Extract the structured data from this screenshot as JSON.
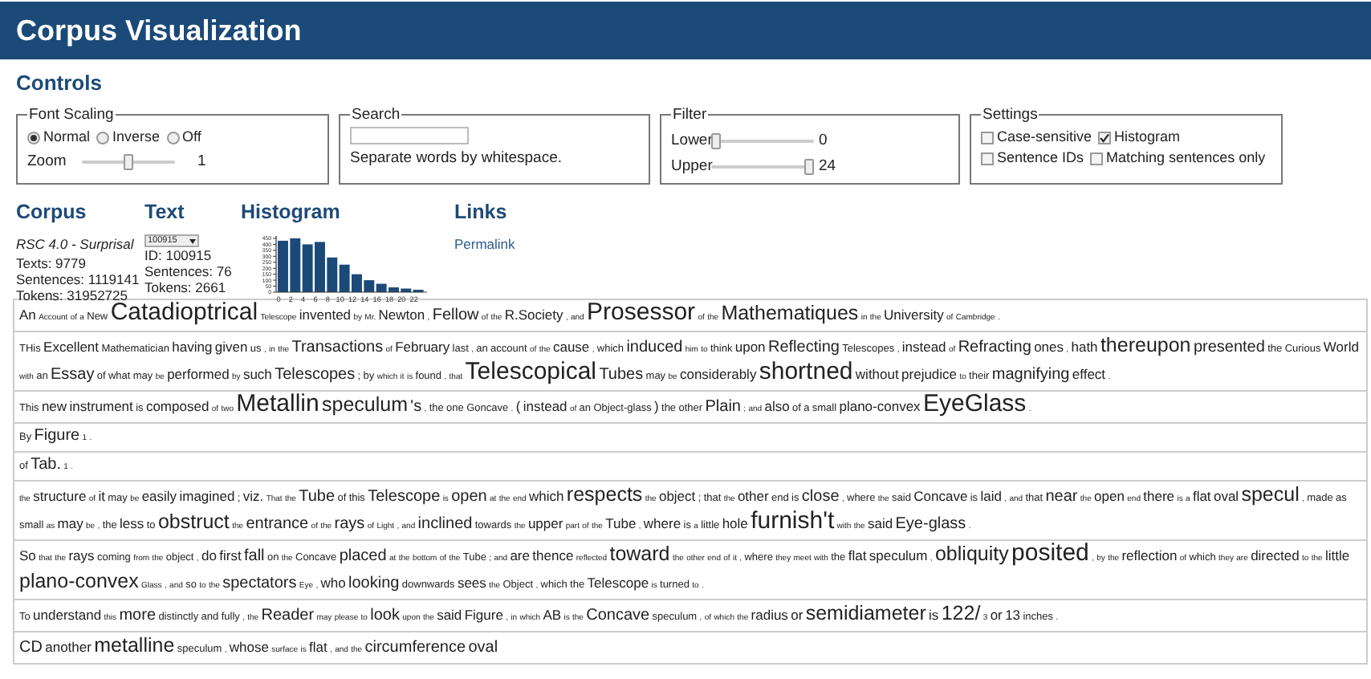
{
  "header": {
    "title": "Corpus Visualization"
  },
  "controls": {
    "heading": "Controls",
    "font_scaling": {
      "legend": "Font Scaling",
      "options": [
        {
          "label": "Normal",
          "selected": true
        },
        {
          "label": "Inverse",
          "selected": false
        },
        {
          "label": "Off",
          "selected": false
        }
      ],
      "zoom": {
        "label": "Zoom",
        "level": 0.5,
        "reading": "1"
      }
    },
    "search": {
      "legend": "Search",
      "hint": "Separate words by whitespace."
    },
    "filter": {
      "legend": "Filter",
      "sliders": [
        {
          "label": "Lower",
          "level": 0,
          "reading": "0"
        },
        {
          "label": "Upper",
          "level": 1,
          "reading": "24"
        }
      ]
    },
    "settings": {
      "legend": "Settings",
      "rows": [
        [
          {
            "label": "Case-sensitive",
            "checked": false
          },
          {
            "label": "Histogram",
            "checked": true
          }
        ],
        [
          {
            "label": "Sentence IDs",
            "checked": false
          },
          {
            "label": "Matching sentences only",
            "checked": false
          }
        ]
      ]
    }
  },
  "corpus": {
    "heading": "Corpus",
    "name": "RSC 4.0 - Surprisal",
    "lines": [
      "Texts: 9779",
      "Sentences: 1119141",
      "Tokens: 31952725"
    ]
  },
  "text": {
    "heading": "Text",
    "select": "100915",
    "lines": [
      "ID: 100915",
      "Sentences: 76",
      "Tokens: 2661"
    ]
  },
  "histogram": {
    "heading": "Histogram",
    "chart_data": {
      "type": "bar",
      "categories": [
        "0",
        "2",
        "4",
        "6",
        "8",
        "10",
        "12",
        "14",
        "16",
        "18",
        "20",
        "22"
      ],
      "values": [
        430,
        450,
        400,
        420,
        290,
        230,
        150,
        100,
        70,
        40,
        30,
        20
      ],
      "yticks": [
        0,
        50,
        100,
        150,
        200,
        250,
        300,
        350,
        400,
        450
      ],
      "ylim": [
        0,
        470
      ]
    }
  },
  "links": {
    "heading": "Links",
    "items": [
      "Permalink"
    ]
  },
  "sentences": [
    [
      {
        "w": "An",
        "kind": "m"
      },
      {
        "w": "Account",
        "kind": "xs"
      },
      {
        "w": "of",
        "kind": "xs"
      },
      {
        "w": "a",
        "kind": "xs"
      },
      {
        "w": "New",
        "kind": "s"
      },
      {
        "w": "Catadioptrical",
        "kind": "xxl"
      },
      {
        "w": "Telescope",
        "kind": "xs"
      },
      {
        "w": "invented",
        "kind": "m"
      },
      {
        "w": "by",
        "kind": "xs"
      },
      {
        "w": "Mr.",
        "kind": "xs"
      },
      {
        "w": "Newton",
        "kind": "m"
      },
      {
        "w": ",",
        "kind": "xs"
      },
      {
        "w": "Fellow",
        "kind": "l"
      },
      {
        "w": "of",
        "kind": "xs"
      },
      {
        "w": "the",
        "kind": "xs"
      },
      {
        "w": "R.Society",
        "kind": "m"
      },
      {
        "w": ",",
        "kind": "xs"
      },
      {
        "w": "and",
        "kind": "xs"
      },
      {
        "w": "Prosessor",
        "kind": "xxl"
      },
      {
        "w": "of",
        "kind": "xs"
      },
      {
        "w": "the",
        "kind": "xs"
      },
      {
        "w": "Mathematiques",
        "kind": "xl"
      },
      {
        "w": "in",
        "kind": "xs"
      },
      {
        "w": "the",
        "kind": "xs"
      },
      {
        "w": "University",
        "kind": "m"
      },
      {
        "w": "of",
        "kind": "xs"
      },
      {
        "w": "Cambridge",
        "kind": "xs"
      },
      {
        "w": ".",
        "kind": "xs"
      }
    ],
    [
      {
        "w": "THis",
        "kind": "s"
      },
      {
        "w": "Excellent",
        "kind": "m"
      },
      {
        "w": "Mathematician",
        "kind": "s"
      },
      {
        "w": "having",
        "kind": "m"
      },
      {
        "w": "given",
        "kind": "m"
      },
      {
        "w": "us",
        "kind": "s"
      },
      {
        "w": ",",
        "kind": "xs"
      },
      {
        "w": "in",
        "kind": "xs"
      },
      {
        "w": "the",
        "kind": "xs"
      },
      {
        "w": "Transactions",
        "kind": "l"
      },
      {
        "w": "of",
        "kind": "xs"
      },
      {
        "w": "February",
        "kind": "m"
      },
      {
        "w": "last",
        "kind": "s"
      },
      {
        "w": ",",
        "kind": "xs"
      },
      {
        "w": "an",
        "kind": "s"
      },
      {
        "w": "account",
        "kind": "s"
      },
      {
        "w": "of",
        "kind": "xs"
      },
      {
        "w": "the",
        "kind": "xs"
      },
      {
        "w": "cause",
        "kind": "m"
      },
      {
        "w": ",",
        "kind": "xs"
      },
      {
        "w": "which",
        "kind": "s"
      },
      {
        "w": "induced",
        "kind": "l"
      },
      {
        "w": "him",
        "kind": "xs"
      },
      {
        "w": "to",
        "kind": "xs"
      },
      {
        "w": "think",
        "kind": "s"
      },
      {
        "w": "upon",
        "kind": "m"
      },
      {
        "w": "Reflecting",
        "kind": "l"
      },
      {
        "w": "Telescopes",
        "kind": "s"
      },
      {
        "w": ",",
        "kind": "xs"
      },
      {
        "w": "instead",
        "kind": "m"
      },
      {
        "w": "of",
        "kind": "xs"
      },
      {
        "w": "Refracting",
        "kind": "l"
      },
      {
        "w": "ones",
        "kind": "m"
      },
      {
        "w": ",",
        "kind": "xs"
      },
      {
        "w": "hath",
        "kind": "m"
      },
      {
        "w": "thereupon",
        "kind": "xl"
      },
      {
        "w": "presented",
        "kind": "l"
      },
      {
        "w": "the",
        "kind": "s"
      },
      {
        "w": "Curious",
        "kind": "s"
      },
      {
        "w": "World",
        "kind": "m"
      },
      {
        "w": "with",
        "kind": "xs"
      },
      {
        "w": "an",
        "kind": "s"
      },
      {
        "w": "Essay",
        "kind": "l"
      },
      {
        "w": "of",
        "kind": "s"
      },
      {
        "w": "what",
        "kind": "s"
      },
      {
        "w": "may",
        "kind": "s"
      },
      {
        "w": "be",
        "kind": "xs"
      },
      {
        "w": "performed",
        "kind": "m"
      },
      {
        "w": "by",
        "kind": "xs"
      },
      {
        "w": "such",
        "kind": "m"
      },
      {
        "w": "Telescopes",
        "kind": "l"
      },
      {
        "w": ";",
        "kind": "s"
      },
      {
        "w": "by",
        "kind": "s"
      },
      {
        "w": "which",
        "kind": "xs"
      },
      {
        "w": "it",
        "kind": "xs"
      },
      {
        "w": "is",
        "kind": "xs"
      },
      {
        "w": "found",
        "kind": "s"
      },
      {
        "w": ",",
        "kind": "xs"
      },
      {
        "w": "that",
        "kind": "xs"
      },
      {
        "w": "Telescopical",
        "kind": "xxl"
      },
      {
        "w": "Tubes",
        "kind": "l"
      },
      {
        "w": "may",
        "kind": "s"
      },
      {
        "w": "be",
        "kind": "xs"
      },
      {
        "w": "considerably",
        "kind": "m"
      },
      {
        "w": "shortned",
        "kind": "xxl"
      },
      {
        "w": "without",
        "kind": "m"
      },
      {
        "w": "prejudice",
        "kind": "m"
      },
      {
        "w": "to",
        "kind": "xs"
      },
      {
        "w": "their",
        "kind": "s"
      },
      {
        "w": "magnifying",
        "kind": "l"
      },
      {
        "w": "effect",
        "kind": "m"
      },
      {
        "w": ".",
        "kind": "xs"
      }
    ],
    [
      {
        "w": "This",
        "kind": "s"
      },
      {
        "w": "new",
        "kind": "m"
      },
      {
        "w": "instrument",
        "kind": "m"
      },
      {
        "w": "is",
        "kind": "s"
      },
      {
        "w": "composed",
        "kind": "m"
      },
      {
        "w": "of",
        "kind": "xs"
      },
      {
        "w": "two",
        "kind": "xs"
      },
      {
        "w": "Metallin",
        "kind": "xxl"
      },
      {
        "w": "speculum",
        "kind": "xl"
      },
      {
        "w": "'s",
        "kind": "l"
      },
      {
        "w": ",",
        "kind": "xs"
      },
      {
        "w": "the",
        "kind": "s"
      },
      {
        "w": "one",
        "kind": "s"
      },
      {
        "w": "Goncave",
        "kind": "s"
      },
      {
        "w": ".",
        "kind": "xs"
      },
      {
        "w": "(",
        "kind": "m"
      },
      {
        "w": "instead",
        "kind": "m"
      },
      {
        "w": "of",
        "kind": "xs"
      },
      {
        "w": "an",
        "kind": "s"
      },
      {
        "w": "Object-glass",
        "kind": "s"
      },
      {
        "w": ")",
        "kind": "m"
      },
      {
        "w": "the",
        "kind": "s"
      },
      {
        "w": "other",
        "kind": "s"
      },
      {
        "w": "Plain",
        "kind": "l"
      },
      {
        "w": ";",
        "kind": "xs"
      },
      {
        "w": "and",
        "kind": "xs"
      },
      {
        "w": "also",
        "kind": "m"
      },
      {
        "w": "of",
        "kind": "s"
      },
      {
        "w": "a",
        "kind": "s"
      },
      {
        "w": "small",
        "kind": "s"
      },
      {
        "w": "plano-convex",
        "kind": "m"
      },
      {
        "w": "EyeGlass",
        "kind": "xxl"
      },
      {
        "w": ".",
        "kind": "xs"
      }
    ],
    [
      {
        "w": "By",
        "kind": "s"
      },
      {
        "w": "Figure",
        "kind": "l"
      },
      {
        "w": "1",
        "kind": "xs"
      },
      {
        "w": ".",
        "kind": "xs"
      }
    ],
    [
      {
        "w": "of",
        "kind": "s"
      },
      {
        "w": "Tab.",
        "kind": "l"
      },
      {
        "w": "1",
        "kind": "xs"
      },
      {
        "w": ".",
        "kind": "xs"
      }
    ],
    [
      {
        "w": "the",
        "kind": "xs"
      },
      {
        "w": "structure",
        "kind": "m"
      },
      {
        "w": "of",
        "kind": "xs"
      },
      {
        "w": "it",
        "kind": "m"
      },
      {
        "w": "may",
        "kind": "s"
      },
      {
        "w": "be",
        "kind": "xs"
      },
      {
        "w": "easily",
        "kind": "m"
      },
      {
        "w": "imagined",
        "kind": "m"
      },
      {
        "w": ";",
        "kind": "s"
      },
      {
        "w": "viz.",
        "kind": "m"
      },
      {
        "w": "That",
        "kind": "xs"
      },
      {
        "w": "the",
        "kind": "xs"
      },
      {
        "w": "Tube",
        "kind": "l"
      },
      {
        "w": "of",
        "kind": "s"
      },
      {
        "w": "this",
        "kind": "s"
      },
      {
        "w": "Telescope",
        "kind": "l"
      },
      {
        "w": "is",
        "kind": "xs"
      },
      {
        "w": "open",
        "kind": "l"
      },
      {
        "w": "at",
        "kind": "xs"
      },
      {
        "w": "the",
        "kind": "xs"
      },
      {
        "w": "end",
        "kind": "xs"
      },
      {
        "w": "which",
        "kind": "m"
      },
      {
        "w": "respects",
        "kind": "xl"
      },
      {
        "w": "the",
        "kind": "xs"
      },
      {
        "w": "object",
        "kind": "m"
      },
      {
        "w": ";",
        "kind": "s"
      },
      {
        "w": "that",
        "kind": "s"
      },
      {
        "w": "the",
        "kind": "xs"
      },
      {
        "w": "other",
        "kind": "m"
      },
      {
        "w": "end",
        "kind": "s"
      },
      {
        "w": "is",
        "kind": "s"
      },
      {
        "w": "close",
        "kind": "l"
      },
      {
        "w": ",",
        "kind": "xs"
      },
      {
        "w": "where",
        "kind": "s"
      },
      {
        "w": "the",
        "kind": "xs"
      },
      {
        "w": "said",
        "kind": "s"
      },
      {
        "w": "Concave",
        "kind": "m"
      },
      {
        "w": "is",
        "kind": "s"
      },
      {
        "w": "laid",
        "kind": "m"
      },
      {
        "w": ",",
        "kind": "xs"
      },
      {
        "w": "and",
        "kind": "xs"
      },
      {
        "w": "that",
        "kind": "s"
      },
      {
        "w": "near",
        "kind": "l"
      },
      {
        "w": "the",
        "kind": "xs"
      },
      {
        "w": "open",
        "kind": "m"
      },
      {
        "w": "end",
        "kind": "xs"
      },
      {
        "w": "there",
        "kind": "m"
      },
      {
        "w": "is",
        "kind": "xs"
      },
      {
        "w": "a",
        "kind": "xs"
      },
      {
        "w": "flat",
        "kind": "m"
      },
      {
        "w": "oval",
        "kind": "m"
      },
      {
        "w": "specul",
        "kind": "xl"
      },
      {
        "w": ",",
        "kind": "xs"
      },
      {
        "w": "made",
        "kind": "s"
      },
      {
        "w": "as",
        "kind": "s"
      },
      {
        "w": "small",
        "kind": "s"
      },
      {
        "w": "as",
        "kind": "xs"
      },
      {
        "w": "may",
        "kind": "m"
      },
      {
        "w": "be",
        "kind": "xs"
      },
      {
        "w": ",",
        "kind": "xs"
      },
      {
        "w": "the",
        "kind": "s"
      },
      {
        "w": "less",
        "kind": "m"
      },
      {
        "w": "to",
        "kind": "s"
      },
      {
        "w": "obstruct",
        "kind": "xl"
      },
      {
        "w": "the",
        "kind": "xs"
      },
      {
        "w": "entrance",
        "kind": "l"
      },
      {
        "w": "of",
        "kind": "xs"
      },
      {
        "w": "the",
        "kind": "xs"
      },
      {
        "w": "rays",
        "kind": "l"
      },
      {
        "w": "of",
        "kind": "xs"
      },
      {
        "w": "Light",
        "kind": "xs"
      },
      {
        "w": ",",
        "kind": "xs"
      },
      {
        "w": "and",
        "kind": "xs"
      },
      {
        "w": "inclined",
        "kind": "l"
      },
      {
        "w": "towards",
        "kind": "s"
      },
      {
        "w": "the",
        "kind": "xs"
      },
      {
        "w": "upper",
        "kind": "m"
      },
      {
        "w": "part",
        "kind": "xs"
      },
      {
        "w": "of",
        "kind": "xs"
      },
      {
        "w": "the",
        "kind": "xs"
      },
      {
        "w": "Tube",
        "kind": "m"
      },
      {
        "w": ",",
        "kind": "xs"
      },
      {
        "w": "where",
        "kind": "m"
      },
      {
        "w": "is",
        "kind": "s"
      },
      {
        "w": "a",
        "kind": "xs"
      },
      {
        "w": "little",
        "kind": "s"
      },
      {
        "w": "hole",
        "kind": "m"
      },
      {
        "w": "furnish't",
        "kind": "xxl"
      },
      {
        "w": "with",
        "kind": "xs"
      },
      {
        "w": "the",
        "kind": "xs"
      },
      {
        "w": "said",
        "kind": "m"
      },
      {
        "w": "Eye-glass",
        "kind": "l"
      },
      {
        "w": ".",
        "kind": "xs"
      }
    ],
    [
      {
        "w": "So",
        "kind": "m"
      },
      {
        "w": "that",
        "kind": "xs"
      },
      {
        "w": "the",
        "kind": "xs"
      },
      {
        "w": "rays",
        "kind": "m"
      },
      {
        "w": "coming",
        "kind": "s"
      },
      {
        "w": "from",
        "kind": "xs"
      },
      {
        "w": "the",
        "kind": "xs"
      },
      {
        "w": "object",
        "kind": "s"
      },
      {
        "w": ",",
        "kind": "xs"
      },
      {
        "w": "do",
        "kind": "m"
      },
      {
        "w": "first",
        "kind": "m"
      },
      {
        "w": "fall",
        "kind": "l"
      },
      {
        "w": "on",
        "kind": "s"
      },
      {
        "w": "the",
        "kind": "xs"
      },
      {
        "w": "Concave",
        "kind": "s"
      },
      {
        "w": "placed",
        "kind": "l"
      },
      {
        "w": "at",
        "kind": "xs"
      },
      {
        "w": "the",
        "kind": "xs"
      },
      {
        "w": "bottom",
        "kind": "xs"
      },
      {
        "w": "of",
        "kind": "xs"
      },
      {
        "w": "the",
        "kind": "xs"
      },
      {
        "w": "Tube",
        "kind": "s"
      },
      {
        "w": ";",
        "kind": "xs"
      },
      {
        "w": "and",
        "kind": "xs"
      },
      {
        "w": "are",
        "kind": "m"
      },
      {
        "w": "thence",
        "kind": "m"
      },
      {
        "w": "reflected",
        "kind": "xs"
      },
      {
        "w": "toward",
        "kind": "xl"
      },
      {
        "w": "the",
        "kind": "xs"
      },
      {
        "w": "other",
        "kind": "xs"
      },
      {
        "w": "end",
        "kind": "xs"
      },
      {
        "w": "of",
        "kind": "xs"
      },
      {
        "w": "it",
        "kind": "xs"
      },
      {
        "w": ",",
        "kind": "xs"
      },
      {
        "w": "where",
        "kind": "s"
      },
      {
        "w": "they",
        "kind": "xs"
      },
      {
        "w": "meet",
        "kind": "xs"
      },
      {
        "w": "with",
        "kind": "xs"
      },
      {
        "w": "the",
        "kind": "s"
      },
      {
        "w": "flat",
        "kind": "m"
      },
      {
        "w": "speculum",
        "kind": "m"
      },
      {
        "w": ",",
        "kind": "xs"
      },
      {
        "w": "obliquity",
        "kind": "xl"
      },
      {
        "w": "posited",
        "kind": "xxl"
      },
      {
        "w": ",",
        "kind": "xs"
      },
      {
        "w": "by",
        "kind": "xs"
      },
      {
        "w": "the",
        "kind": "xs"
      },
      {
        "w": "reflection",
        "kind": "m"
      },
      {
        "w": "of",
        "kind": "xs"
      },
      {
        "w": "which",
        "kind": "s"
      },
      {
        "w": "they",
        "kind": "xs"
      },
      {
        "w": "are",
        "kind": "xs"
      },
      {
        "w": "directed",
        "kind": "m"
      },
      {
        "w": "to",
        "kind": "xs"
      },
      {
        "w": "the",
        "kind": "xs"
      },
      {
        "w": "little",
        "kind": "m"
      },
      {
        "w": "plano-convex",
        "kind": "xl"
      },
      {
        "w": "Glass",
        "kind": "xs"
      },
      {
        "w": ",",
        "kind": "xs"
      },
      {
        "w": "and",
        "kind": "xs"
      },
      {
        "w": "so",
        "kind": "s"
      },
      {
        "w": "to",
        "kind": "xs"
      },
      {
        "w": "the",
        "kind": "xs"
      },
      {
        "w": "spectators",
        "kind": "l"
      },
      {
        "w": "Eye",
        "kind": "xs"
      },
      {
        "w": ",",
        "kind": "xs"
      },
      {
        "w": "who",
        "kind": "m"
      },
      {
        "w": "looking",
        "kind": "l"
      },
      {
        "w": "downwards",
        "kind": "s"
      },
      {
        "w": "sees",
        "kind": "m"
      },
      {
        "w": "the",
        "kind": "xs"
      },
      {
        "w": "Object",
        "kind": "s"
      },
      {
        "w": ",",
        "kind": "xs"
      },
      {
        "w": "which",
        "kind": "s"
      },
      {
        "w": "the",
        "kind": "s"
      },
      {
        "w": "Telescope",
        "kind": "m"
      },
      {
        "w": "is",
        "kind": "xs"
      },
      {
        "w": "turned",
        "kind": "s"
      },
      {
        "w": "to",
        "kind": "xs"
      },
      {
        "w": ".",
        "kind": "xs"
      }
    ],
    [
      {
        "w": "To",
        "kind": "s"
      },
      {
        "w": "understand",
        "kind": "m"
      },
      {
        "w": "this",
        "kind": "xs"
      },
      {
        "w": "more",
        "kind": "l"
      },
      {
        "w": "distinctly",
        "kind": "s"
      },
      {
        "w": "and",
        "kind": "s"
      },
      {
        "w": "fully",
        "kind": "s"
      },
      {
        "w": ",",
        "kind": "xs"
      },
      {
        "w": "the",
        "kind": "xs"
      },
      {
        "w": "Reader",
        "kind": "l"
      },
      {
        "w": "may",
        "kind": "xs"
      },
      {
        "w": "please",
        "kind": "xs"
      },
      {
        "w": "to",
        "kind": "xs"
      },
      {
        "w": "look",
        "kind": "l"
      },
      {
        "w": "upon",
        "kind": "xs"
      },
      {
        "w": "the",
        "kind": "xs"
      },
      {
        "w": "said",
        "kind": "m"
      },
      {
        "w": "Figure",
        "kind": "m"
      },
      {
        "w": ",",
        "kind": "xs"
      },
      {
        "w": "in",
        "kind": "xs"
      },
      {
        "w": "which",
        "kind": "xs"
      },
      {
        "w": "AB",
        "kind": "m"
      },
      {
        "w": "is",
        "kind": "xs"
      },
      {
        "w": "the",
        "kind": "xs"
      },
      {
        "w": "Concave",
        "kind": "l"
      },
      {
        "w": "speculum",
        "kind": "s"
      },
      {
        "w": ",",
        "kind": "xs"
      },
      {
        "w": "of",
        "kind": "xs"
      },
      {
        "w": "which",
        "kind": "xs"
      },
      {
        "w": "the",
        "kind": "xs"
      },
      {
        "w": "radius",
        "kind": "m"
      },
      {
        "w": "or",
        "kind": "m"
      },
      {
        "w": "semidiameter",
        "kind": "xl"
      },
      {
        "w": "is",
        "kind": "m"
      },
      {
        "w": "122/",
        "kind": "xl"
      },
      {
        "w": "3",
        "kind": "xs"
      },
      {
        "w": "or",
        "kind": "m"
      },
      {
        "w": "13",
        "kind": "m"
      },
      {
        "w": "inches",
        "kind": "s"
      },
      {
        "w": ".",
        "kind": "xs"
      }
    ],
    [
      {
        "w": "CD",
        "kind": "l"
      },
      {
        "w": "another",
        "kind": "m"
      },
      {
        "w": "metalline",
        "kind": "xl"
      },
      {
        "w": "speculum",
        "kind": "s"
      },
      {
        "w": ",",
        "kind": "xs"
      },
      {
        "w": "whose",
        "kind": "m"
      },
      {
        "w": "surface",
        "kind": "xs"
      },
      {
        "w": "is",
        "kind": "xs"
      },
      {
        "w": "flat",
        "kind": "m"
      },
      {
        "w": ",",
        "kind": "xs"
      },
      {
        "w": "and",
        "kind": "xs"
      },
      {
        "w": "the",
        "kind": "xs"
      },
      {
        "w": "circumference",
        "kind": "l"
      },
      {
        "w": "oval",
        "kind": "l"
      }
    ]
  ]
}
